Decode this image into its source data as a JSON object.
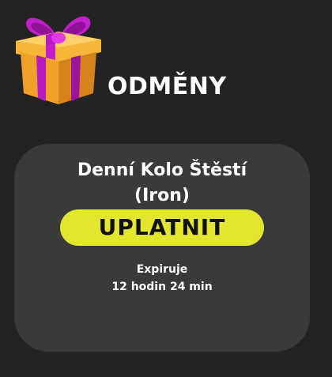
{
  "header": {
    "title": "ODMĚNY",
    "icon": "gift-icon"
  },
  "reward_card": {
    "title_line1": "Denní Kolo Štěstí",
    "title_line2": "(Iron)",
    "claim_label": "UPLATNIT",
    "expiry_label": "Expiruje",
    "expiry_time": "12 hodin 24 min"
  },
  "colors": {
    "background": "#232323",
    "card": "#3a3a3a",
    "button": "#e3e62f",
    "gift_box": "#f2a52a",
    "gift_ribbon": "#c21ec9"
  }
}
